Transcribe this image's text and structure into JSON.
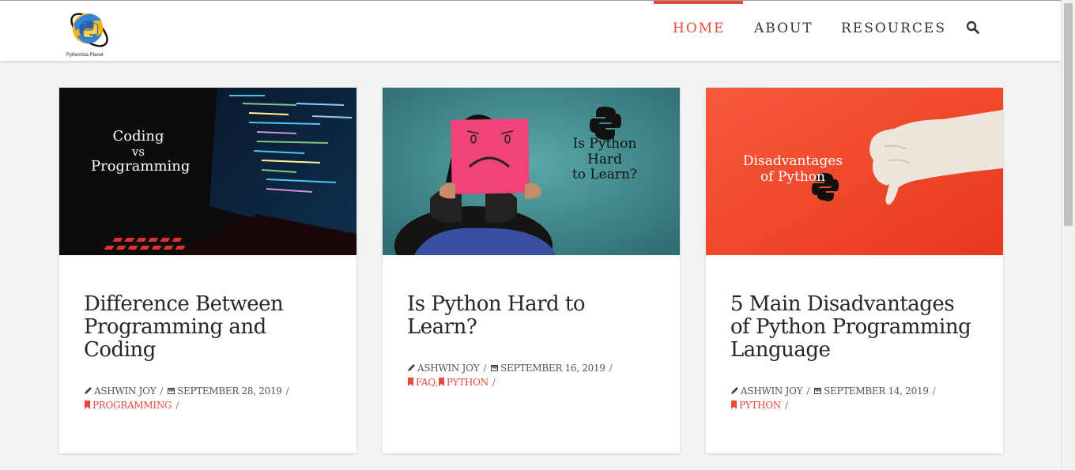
{
  "site": {
    "logo_text": "Pythonista Planet"
  },
  "nav": {
    "home": "HOME",
    "about": "ABOUT",
    "resources": "RESOURCES"
  },
  "colors": {
    "accent": "#e64a3b",
    "text": "#272727"
  },
  "posts": [
    {
      "title": "Difference Between Programming and Coding",
      "thumb_lines": [
        "Coding",
        "vs",
        "Programming"
      ],
      "author": "ASHWIN JOY",
      "date": "SEPTEMBER 28, 2019",
      "categories": [
        "PROGRAMMING"
      ]
    },
    {
      "title": "Is Python Hard to Learn?",
      "thumb_lines": [
        "Is Python Hard",
        "to Learn?"
      ],
      "author": "ASHWIN JOY",
      "date": "SEPTEMBER 16, 2019",
      "categories": [
        "FAQ",
        "PYTHON"
      ]
    },
    {
      "title": "5 Main Disadvantages of Python Programming Language",
      "thumb_lines": [
        "Disadvantages",
        "of Python"
      ],
      "author": "ASHWIN JOY",
      "date": "SEPTEMBER 14, 2019",
      "categories": [
        "PYTHON"
      ]
    }
  ]
}
